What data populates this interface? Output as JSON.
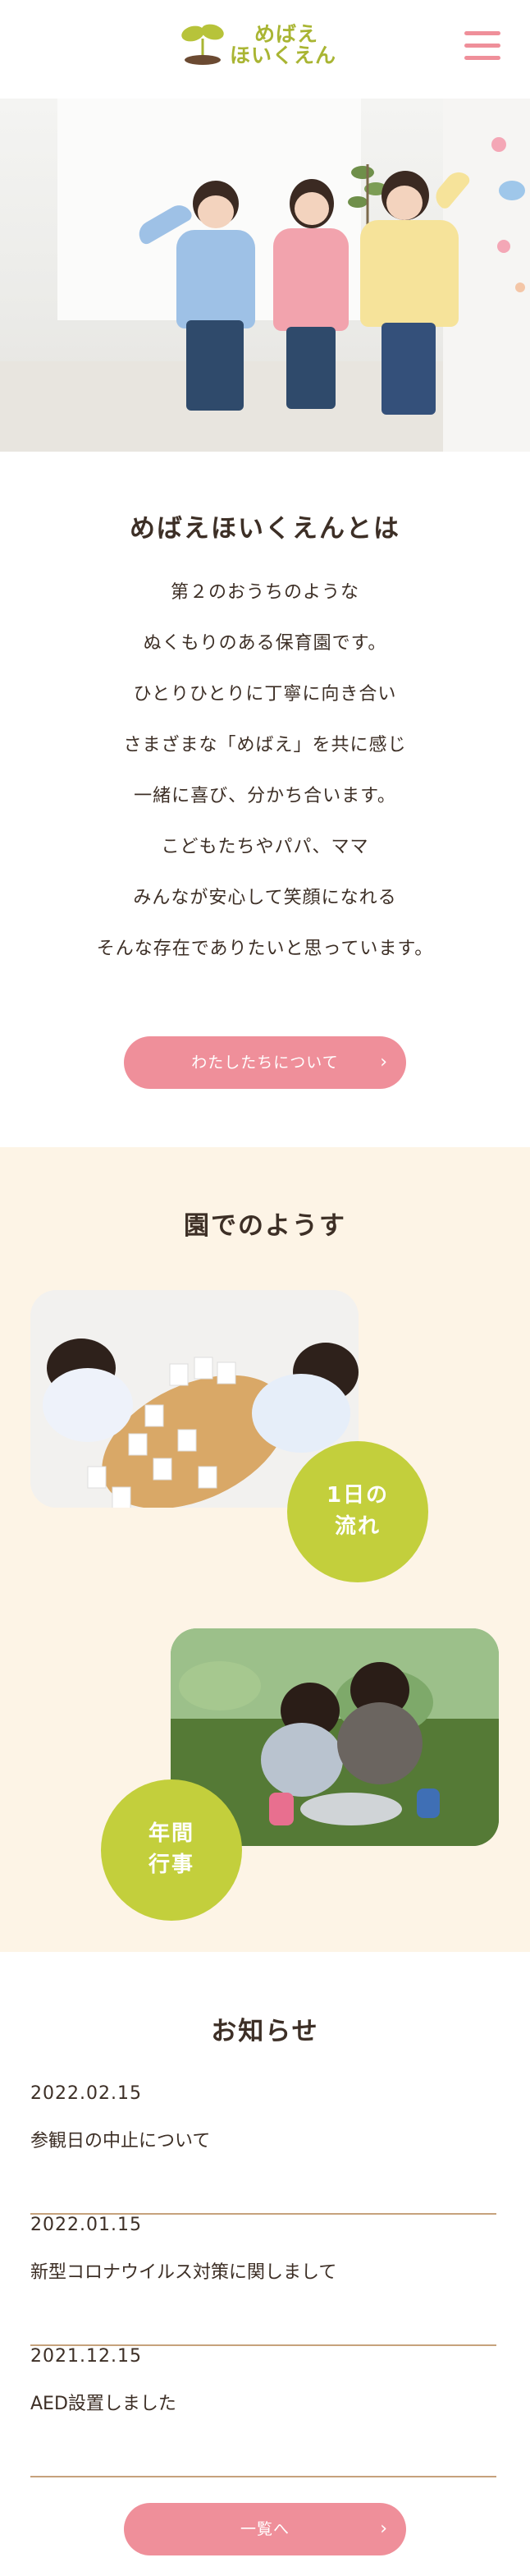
{
  "header": {
    "logo_line1": "めばえ",
    "logo_line2": "ほいくえん",
    "menu_icon": "hamburger-menu-icon",
    "accent_color": "#ef8f9a",
    "logo_color": "#a9b533"
  },
  "about": {
    "title": "めばえほいくえんとは",
    "lines": [
      "第２のおうちのような",
      "ぬくもりのある保育園です。",
      "ひとりひとりに丁寧に向き合い",
      "さまざまな「めばえ」を共に感じ",
      "一緒に喜び、分かち合います。",
      "こどもたちやパパ、ママ",
      "みんなが安心して笑顔になれる",
      "そんな存在でありたいと思っています。"
    ],
    "button_label": "わたしたちについて",
    "button_icon": "chevron-right-icon"
  },
  "garden": {
    "title": "園でのようす",
    "daily_line1": "1日の",
    "daily_line2": "流れ",
    "events_line1": "年間",
    "events_line2": "行事",
    "background": "#fdf4e6",
    "circle_color": "#c3cf3c"
  },
  "news": {
    "title": "お知らせ",
    "items": [
      {
        "date": "2022.02.15",
        "text": "参観日の中止について"
      },
      {
        "date": "2022.01.15",
        "text": "新型コロナウイルス対策に関しまして"
      },
      {
        "date": "2021.12.15",
        "text": "AED設置しました"
      }
    ],
    "button_label": "一覧へ"
  }
}
